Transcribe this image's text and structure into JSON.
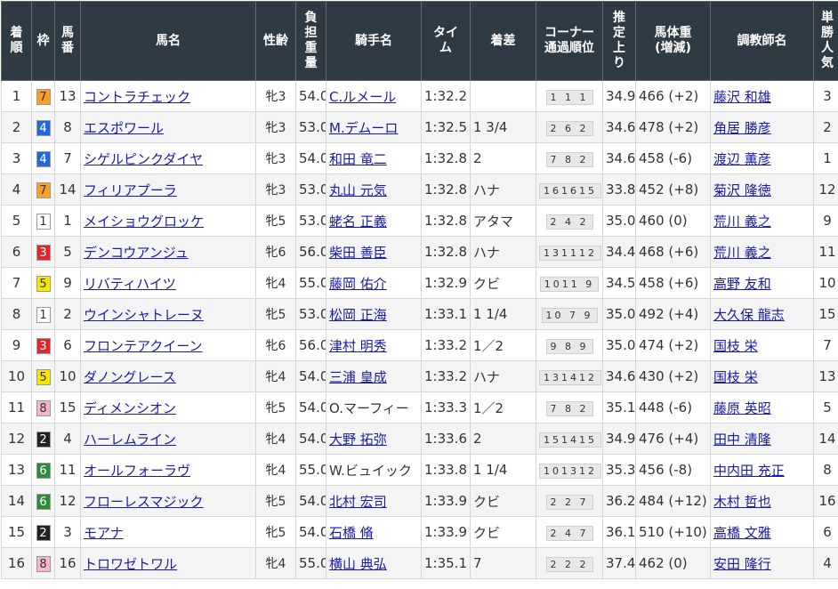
{
  "headers": [
    "着順",
    "枠",
    "馬番",
    "馬名",
    "性齢",
    "負担重量",
    "騎手名",
    "タイム",
    "着差",
    "コーナー通過順位",
    "推定上り",
    "馬体重(増減)",
    "調教師名",
    "単勝人気"
  ],
  "waku_colors": {
    "1": {
      "bg": "#ffffff",
      "fg": "#333333"
    },
    "2": {
      "bg": "#222222",
      "fg": "#ffffff"
    },
    "3": {
      "bg": "#e0262b",
      "fg": "#ffffff"
    },
    "4": {
      "bg": "#2369d6",
      "fg": "#ffffff"
    },
    "5": {
      "bg": "#f7e600",
      "fg": "#333333"
    },
    "6": {
      "bg": "#2e8b3c",
      "fg": "#ffffff"
    },
    "7": {
      "bg": "#f6a02a",
      "fg": "#333333"
    },
    "8": {
      "bg": "#f7b6c8",
      "fg": "#333333"
    }
  },
  "rows": [
    {
      "rank": "1",
      "waku": "7",
      "num": "13",
      "horse": "コントラチェック",
      "sex_age": "牝3",
      "weight": "54.0",
      "jockey": "C.ルメール",
      "jockey_link": true,
      "time": "1:32.2",
      "margin": "",
      "corner": "1 1 1",
      "last3f": "34.9",
      "body": "466 (+2)",
      "trainer": "藤沢 和雄",
      "pop": "3"
    },
    {
      "rank": "2",
      "waku": "4",
      "num": "8",
      "horse": "エスポワール",
      "sex_age": "牝3",
      "weight": "53.0",
      "jockey": "M.デムーロ",
      "jockey_link": true,
      "time": "1:32.5",
      "margin": "1 3/4",
      "corner": "2 6 2",
      "last3f": "34.6",
      "body": "478 (+2)",
      "trainer": "角居 勝彦",
      "pop": "2"
    },
    {
      "rank": "3",
      "waku": "4",
      "num": "7",
      "horse": "シゲルピンクダイヤ",
      "sex_age": "牝3",
      "weight": "54.0",
      "jockey": "和田 竜二",
      "jockey_link": true,
      "time": "1:32.8",
      "margin": "2",
      "corner": "7 8 2",
      "last3f": "34.6",
      "body": "458 (-6)",
      "trainer": "渡辺 薫彦",
      "pop": "1"
    },
    {
      "rank": "4",
      "waku": "7",
      "num": "14",
      "horse": "フィリアプーラ",
      "sex_age": "牝3",
      "weight": "53.0",
      "jockey": "丸山 元気",
      "jockey_link": true,
      "time": "1:32.8",
      "margin": "ハナ",
      "corner": "161615",
      "last3f": "33.8",
      "body": "452 (+8)",
      "trainer": "菊沢 隆徳",
      "pop": "12"
    },
    {
      "rank": "5",
      "waku": "1",
      "num": "1",
      "horse": "メイショウグロッケ",
      "sex_age": "牝5",
      "weight": "53.0",
      "jockey": "蛯名 正義",
      "jockey_link": true,
      "time": "1:32.8",
      "margin": "アタマ",
      "corner": "2 4 2",
      "last3f": "35.0",
      "body": "460 (0)",
      "trainer": "荒川 義之",
      "pop": "9"
    },
    {
      "rank": "6",
      "waku": "3",
      "num": "5",
      "horse": "デンコウアンジュ",
      "sex_age": "牝6",
      "weight": "56.0",
      "jockey": "柴田 善臣",
      "jockey_link": true,
      "time": "1:32.8",
      "margin": "ハナ",
      "corner": "131112",
      "last3f": "34.4",
      "body": "468 (+6)",
      "trainer": "荒川 義之",
      "pop": "11"
    },
    {
      "rank": "7",
      "waku": "5",
      "num": "9",
      "horse": "リバティハイツ",
      "sex_age": "牝4",
      "weight": "55.0",
      "jockey": "藤岡 佑介",
      "jockey_link": true,
      "time": "1:32.9",
      "margin": "クビ",
      "corner": "1011 9",
      "last3f": "34.5",
      "body": "458 (+6)",
      "trainer": "高野 友和",
      "pop": "10"
    },
    {
      "rank": "8",
      "waku": "1",
      "num": "2",
      "horse": "ウインシャトレーヌ",
      "sex_age": "牝5",
      "weight": "53.0",
      "jockey": "松岡 正海",
      "jockey_link": true,
      "time": "1:33.1",
      "margin": "1 1/4",
      "corner": "10 7 9",
      "last3f": "35.0",
      "body": "492 (+4)",
      "trainer": "大久保 龍志",
      "pop": "15"
    },
    {
      "rank": "9",
      "waku": "3",
      "num": "6",
      "horse": "フロンテアクイーン",
      "sex_age": "牝6",
      "weight": "56.0",
      "jockey": "津村 明秀",
      "jockey_link": true,
      "time": "1:33.2",
      "margin": "1／2",
      "corner": "9 8 9",
      "last3f": "35.0",
      "body": "474 (+2)",
      "trainer": "国枝 栄",
      "pop": "7"
    },
    {
      "rank": "10",
      "waku": "5",
      "num": "10",
      "horse": "ダノングレース",
      "sex_age": "牝4",
      "weight": "54.0",
      "jockey": "三浦 皇成",
      "jockey_link": true,
      "time": "1:33.2",
      "margin": "ハナ",
      "corner": "131412",
      "last3f": "34.6",
      "body": "430 (+2)",
      "trainer": "国枝 栄",
      "pop": "13"
    },
    {
      "rank": "11",
      "waku": "8",
      "num": "15",
      "horse": "ディメンシオン",
      "sex_age": "牝5",
      "weight": "54.0",
      "jockey": "O.マーフィー",
      "jockey_link": false,
      "time": "1:33.3",
      "margin": "1／2",
      "corner": "7 8 2",
      "last3f": "35.1",
      "body": "448 (-6)",
      "trainer": "藤原 英昭",
      "pop": "5"
    },
    {
      "rank": "12",
      "waku": "2",
      "num": "4",
      "horse": "ハーレムライン",
      "sex_age": "牝4",
      "weight": "54.0",
      "jockey": "大野 拓弥",
      "jockey_link": true,
      "time": "1:33.6",
      "margin": "2",
      "corner": "151415",
      "last3f": "34.9",
      "body": "476 (+4)",
      "trainer": "田中 清隆",
      "pop": "14"
    },
    {
      "rank": "13",
      "waku": "6",
      "num": "11",
      "horse": "オールフォーラヴ",
      "sex_age": "牝4",
      "weight": "55.0",
      "jockey": "W.ビュイック",
      "jockey_link": false,
      "time": "1:33.8",
      "margin": "1 1/4",
      "corner": "101312",
      "last3f": "35.3",
      "body": "456 (-8)",
      "trainer": "中内田 充正",
      "pop": "8"
    },
    {
      "rank": "14",
      "waku": "6",
      "num": "12",
      "horse": "フローレスマジック",
      "sex_age": "牝5",
      "weight": "54.0",
      "jockey": "北村 宏司",
      "jockey_link": true,
      "time": "1:33.9",
      "margin": "クビ",
      "corner": "2 2 7",
      "last3f": "36.2",
      "body": "484 (+12)",
      "trainer": "木村 哲也",
      "pop": "16"
    },
    {
      "rank": "15",
      "waku": "2",
      "num": "3",
      "horse": "モアナ",
      "sex_age": "牝5",
      "weight": "54.0",
      "jockey": "石橋 脩",
      "jockey_link": true,
      "time": "1:33.9",
      "margin": "クビ",
      "corner": "2 4 7",
      "last3f": "36.1",
      "body": "510 (+10)",
      "trainer": "高橋 文雅",
      "pop": "6"
    },
    {
      "rank": "16",
      "waku": "8",
      "num": "16",
      "horse": "トロワゼトワル",
      "sex_age": "牝4",
      "weight": "55.0",
      "jockey": "横山 典弘",
      "jockey_link": true,
      "time": "1:35.1",
      "margin": "7",
      "corner": "2 2 2",
      "last3f": "37.4",
      "body": "462 (0)",
      "trainer": "安田 隆行",
      "pop": "4"
    }
  ]
}
